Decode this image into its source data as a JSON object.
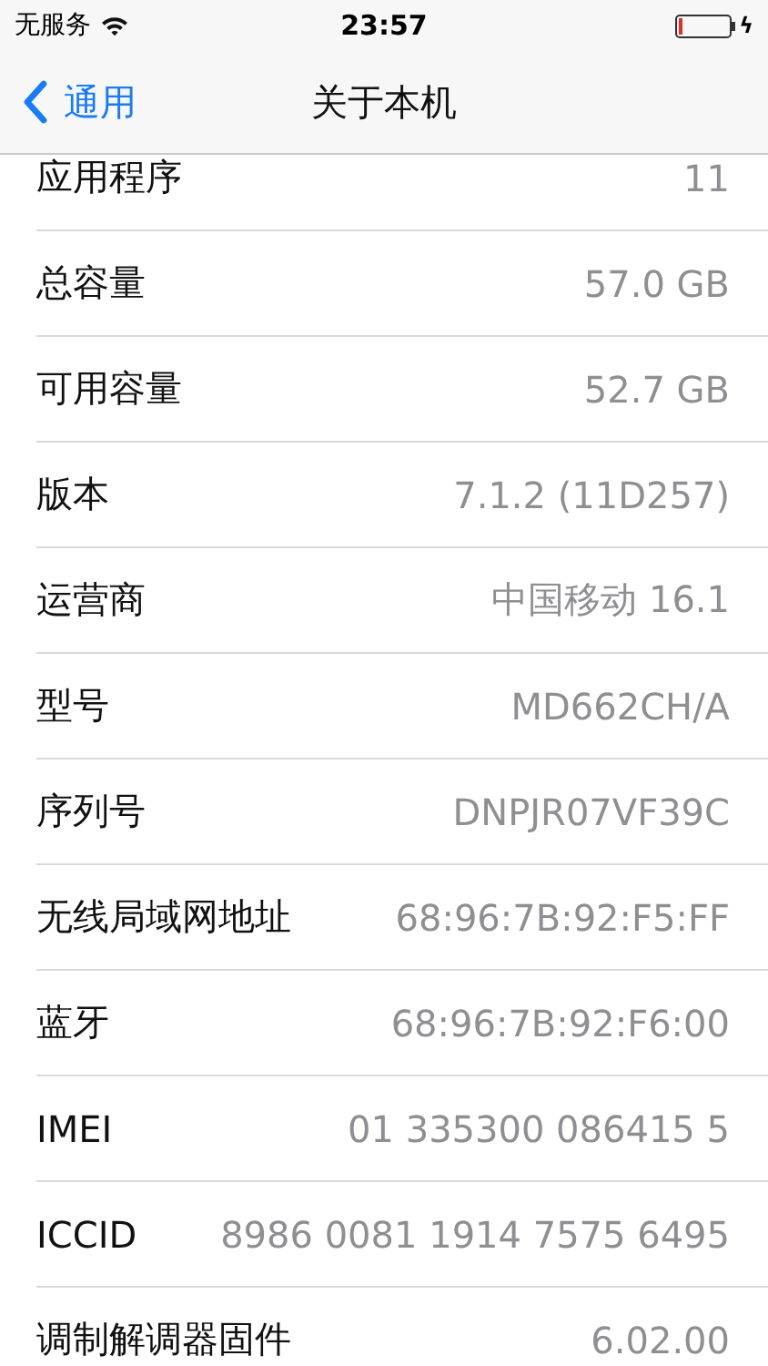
{
  "status_bar": {
    "carrier": "无服务",
    "time": "23:57",
    "charging_icon": "ϟ"
  },
  "nav_bar": {
    "back": "通用",
    "title": "关于本机"
  },
  "rows": [
    {
      "label": "应用程序",
      "value": "11"
    },
    {
      "label": "总容量",
      "value": "57.0 GB"
    },
    {
      "label": "可用容量",
      "value": "52.7 GB"
    },
    {
      "label": "版本",
      "value": "7.1.2 (11D257)"
    },
    {
      "label": "运营商",
      "value": "中国移动 16.1"
    },
    {
      "label": "型号",
      "value": "MD662CH/A"
    },
    {
      "label": "序列号",
      "value": "DNPJR07VF39C"
    },
    {
      "label": "无线局域网地址",
      "value": "68:96:7B:92:F5:FF"
    },
    {
      "label": "蓝牙",
      "value": "68:96:7B:92:F6:00"
    },
    {
      "label": "IMEI",
      "value": "01 335300 086415 5"
    },
    {
      "label": "ICCID",
      "value": "8986 0081 1914 7575 6495"
    },
    {
      "label": "调制解调器固件",
      "value": "6.02.00"
    }
  ]
}
